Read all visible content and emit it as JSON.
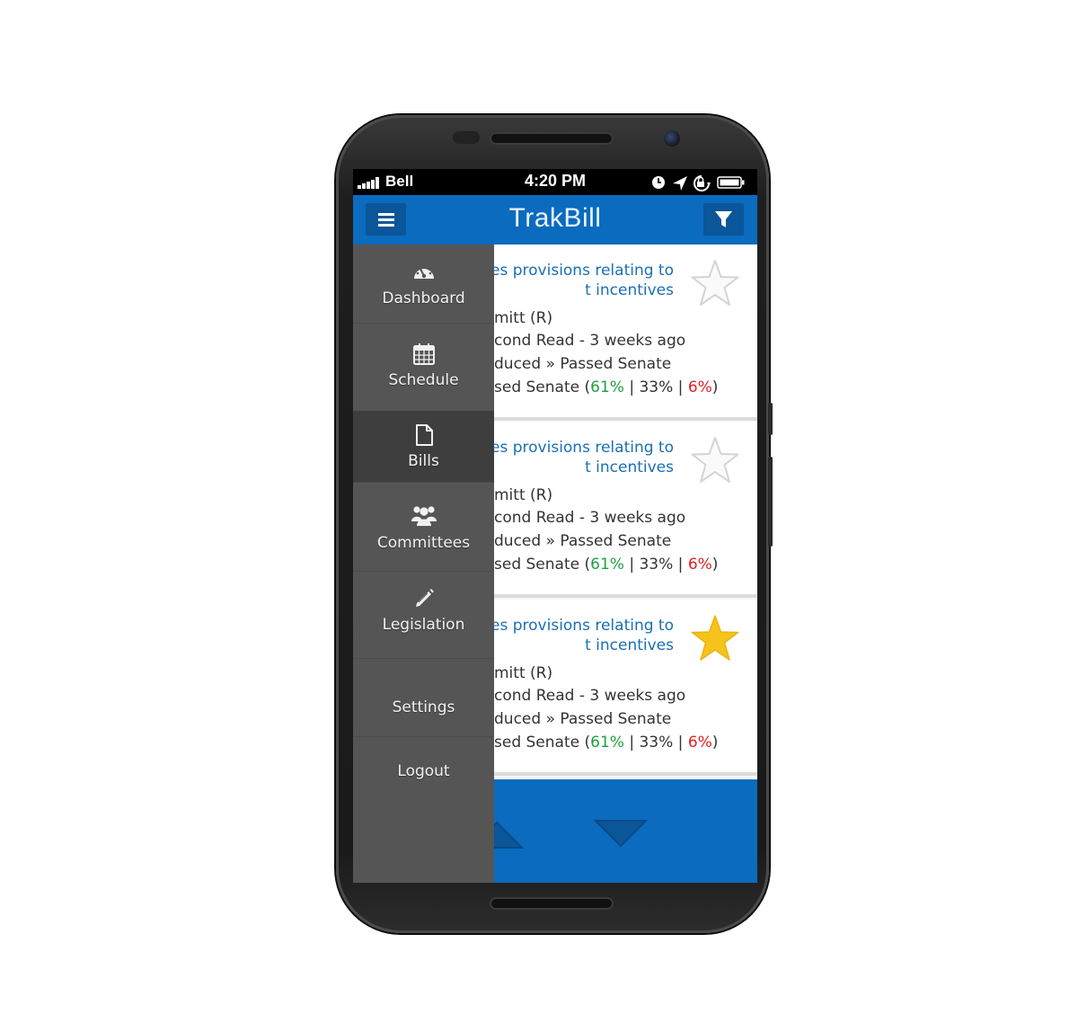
{
  "status_bar": {
    "carrier": "Bell",
    "time": "4:20 PM"
  },
  "app_bar": {
    "title": "TrakBill"
  },
  "drawer": {
    "items": [
      {
        "label": "Dashboard",
        "icon": "dashboard-icon",
        "active": false
      },
      {
        "label": "Schedule",
        "icon": "calendar-icon",
        "active": false
      },
      {
        "label": "Bills",
        "icon": "document-icon",
        "active": true
      },
      {
        "label": "Committees",
        "icon": "users-icon",
        "active": false
      },
      {
        "label": "Legislation",
        "icon": "pencil-icon",
        "active": false
      },
      {
        "label": "Settings",
        "icon": "",
        "active": false
      },
      {
        "label": "Logout",
        "icon": "",
        "active": false
      }
    ]
  },
  "bills": [
    {
      "title_line1": "ies provisions relating to",
      "title_line2": "t incentives",
      "sponsor": "mitt (R)",
      "action": "cond Read - 3 weeks ago",
      "progress": "duced » Passed Senate",
      "status_prefix": "sed Senate (",
      "pct_yes": "61%",
      "sep1": " | ",
      "pct_mid": "33%",
      "sep2": " | ",
      "pct_no": "6%",
      "status_suffix": ")",
      "starred": false
    },
    {
      "title_line1": "ies provisions relating to",
      "title_line2": "t incentives",
      "sponsor": "mitt (R)",
      "action": "cond Read - 3 weeks ago",
      "progress": "duced » Passed Senate",
      "status_prefix": "sed Senate (",
      "pct_yes": "61%",
      "sep1": " | ",
      "pct_mid": "33%",
      "sep2": " | ",
      "pct_no": "6%",
      "status_suffix": ")",
      "starred": false
    },
    {
      "title_line1": "ies provisions relating to",
      "title_line2": "t incentives",
      "sponsor": "mitt (R)",
      "action": "cond Read - 3 weeks ago",
      "progress": "duced » Passed Senate",
      "status_prefix": "sed Senate (",
      "pct_yes": "61%",
      "sep1": " | ",
      "pct_mid": "33%",
      "sep2": " | ",
      "pct_no": "6%",
      "status_suffix": ")",
      "starred": true
    }
  ],
  "colors": {
    "primary": "#0a6bbf",
    "drawer": "#555555",
    "drawer_active": "#3e3e3e",
    "link": "#1a6fb4",
    "yes": "#1ea040",
    "no": "#e02020",
    "star_active": "#f6c21c"
  }
}
